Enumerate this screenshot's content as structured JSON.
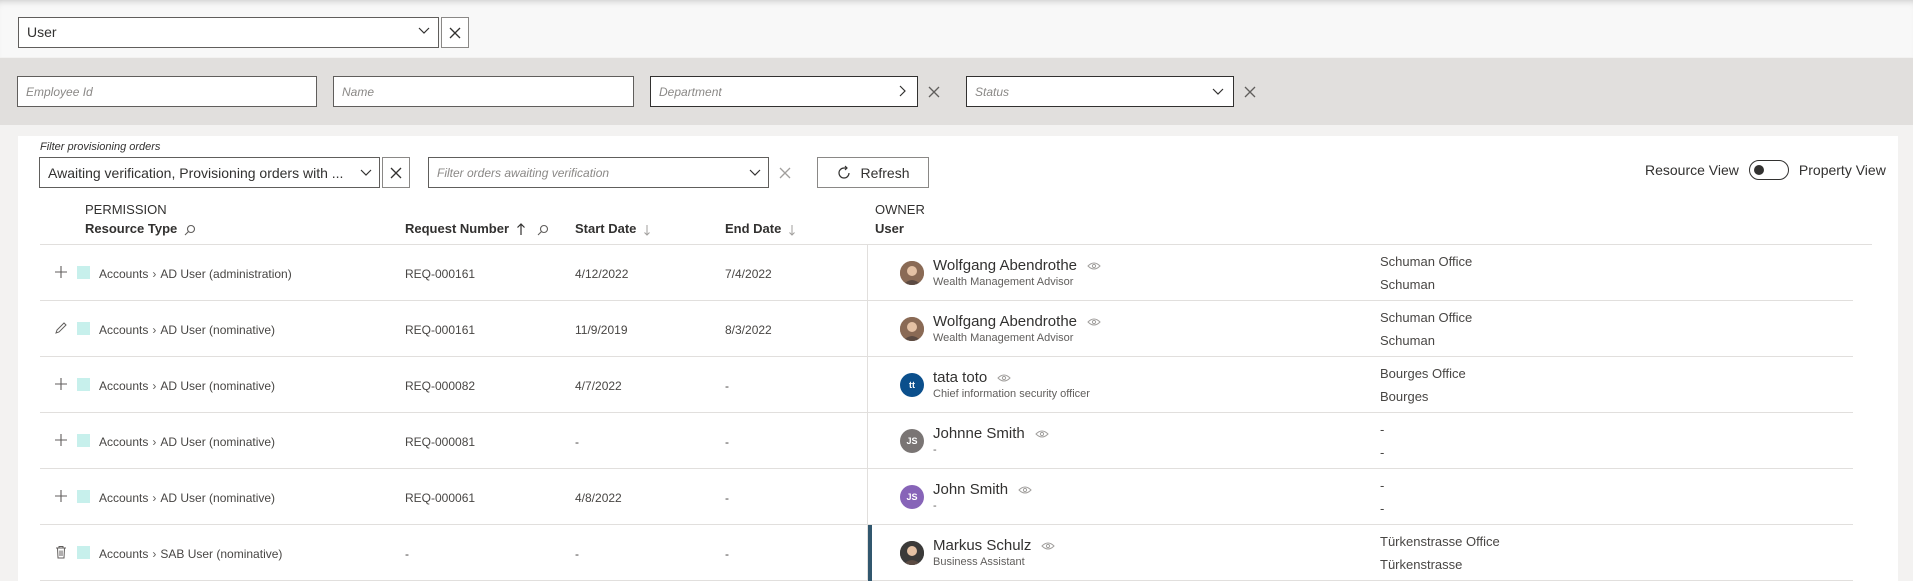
{
  "entity": {
    "value": "User"
  },
  "filters": {
    "employee_id_placeholder": "Employee Id",
    "name_placeholder": "Name",
    "department_placeholder": "Department",
    "status_placeholder": "Status"
  },
  "orders": {
    "label": "Filter provisioning orders",
    "selected": "Awaiting verification, Provisioning orders with ...",
    "verification_placeholder": "Filter orders awaiting verification",
    "refresh_label": "Refresh"
  },
  "view_toggle": {
    "left_label": "Resource View",
    "right_label": "Property View"
  },
  "columns": {
    "permission": "PERMISSION",
    "resource_type": "Resource Type",
    "request_number": "Request Number",
    "start_date": "Start Date",
    "end_date": "End Date",
    "owner": "OWNER",
    "user": "User"
  },
  "rows": [
    {
      "action": "add",
      "category": "Accounts",
      "resource": "AD User (administration)",
      "request": "REQ-000161",
      "start": "4/12/2022",
      "end": "7/4/2022",
      "avatar_type": "photo",
      "avatar_color": "#8a6a55",
      "initials": "",
      "owner": "Wolfgang Abendrothe",
      "role": "Wealth Management Advisor",
      "loc1": "Schuman Office",
      "loc2": "Schuman"
    },
    {
      "action": "edit",
      "category": "Accounts",
      "resource": "AD User (nominative)",
      "request": "REQ-000161",
      "start": "11/9/2019",
      "end": "8/3/2022",
      "avatar_type": "photo",
      "avatar_color": "#8a6a55",
      "initials": "",
      "owner": "Wolfgang Abendrothe",
      "role": "Wealth Management Advisor",
      "loc1": "Schuman Office",
      "loc2": "Schuman"
    },
    {
      "action": "add",
      "category": "Accounts",
      "resource": "AD User (nominative)",
      "request": "REQ-000082",
      "start": "4/7/2022",
      "end": "-",
      "avatar_type": "initials",
      "avatar_color": "#0b4f8c",
      "initials": "tt",
      "owner": "tata toto",
      "role": "Chief information security officer",
      "loc1": "Bourges Office",
      "loc2": "Bourges"
    },
    {
      "action": "add",
      "category": "Accounts",
      "resource": "AD User (nominative)",
      "request": "REQ-000081",
      "start": "-",
      "end": "-",
      "avatar_type": "initials",
      "avatar_color": "#7a7574",
      "initials": "JS",
      "owner": "Johnne Smith",
      "role": "-",
      "loc1": "-",
      "loc2": "-"
    },
    {
      "action": "add",
      "category": "Accounts",
      "resource": "AD User (nominative)",
      "request": "REQ-000061",
      "start": "4/8/2022",
      "end": "-",
      "avatar_type": "initials",
      "avatar_color": "#8764b8",
      "initials": "JS",
      "owner": "John Smith",
      "role": "-",
      "loc1": "-",
      "loc2": "-"
    },
    {
      "action": "delete",
      "category": "Accounts",
      "resource": "SAB User (nominative)",
      "request": "-",
      "start": "-",
      "end": "-",
      "avatar_type": "photo",
      "avatar_color": "#3b3a39",
      "initials": "",
      "owner": "Markus Schulz",
      "role": "Business Assistant",
      "loc1": "Türkenstrasse Office",
      "loc2": "Türkenstrasse",
      "selected": true
    }
  ]
}
